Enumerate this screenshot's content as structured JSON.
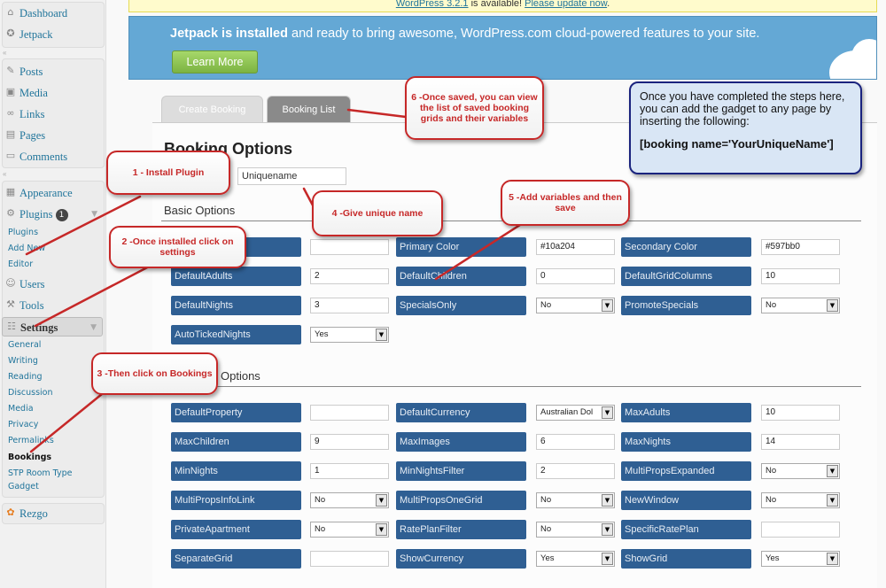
{
  "sidebar": {
    "top_items": [
      {
        "label": "Dashboard",
        "icon": "home-icon"
      },
      {
        "label": "Jetpack",
        "icon": "jetpack-icon"
      }
    ],
    "content_items": [
      {
        "label": "Posts",
        "icon": "pin-icon"
      },
      {
        "label": "Media",
        "icon": "media-icon"
      },
      {
        "label": "Links",
        "icon": "link-icon"
      },
      {
        "label": "Pages",
        "icon": "page-icon"
      },
      {
        "label": "Comments",
        "icon": "comment-icon"
      }
    ],
    "admin_items": [
      {
        "label": "Appearance",
        "icon": "appearance-icon"
      },
      {
        "label": "Plugins",
        "icon": "plugin-icon",
        "badge": "1"
      }
    ],
    "plugins_sub": [
      "Plugins",
      "Add New",
      "Editor"
    ],
    "users": {
      "label": "Users",
      "icon": "users-icon"
    },
    "tools": {
      "label": "Tools",
      "icon": "tools-icon"
    },
    "settings": {
      "label": "Settings",
      "icon": "settings-icon"
    },
    "settings_sub": [
      "General",
      "Writing",
      "Reading",
      "Discussion",
      "Media",
      "Privacy",
      "Permalinks",
      "Bookings",
      "STP Room Type",
      "Gadget"
    ],
    "rezgo": {
      "label": "Rezgo",
      "icon": "rezgo-icon"
    }
  },
  "update_notice": {
    "version": "WordPress 3.2.1",
    "text": " is available! ",
    "link": "Please update now",
    "end": "."
  },
  "jetpack_notice": {
    "bold": "Jetpack is installed",
    "text": " and ready to bring awesome, WordPress.com cloud-powered features to your site.",
    "button": "Learn More"
  },
  "tabs": {
    "create": "Create Booking",
    "list": "Booking List"
  },
  "page_title": "Booking Options",
  "unique_name_value": "Uniquename",
  "sections": {
    "basic": "Basic Options",
    "advanced": "Options"
  },
  "basic_fields": [
    {
      "label": "",
      "value": "",
      "kind": "input"
    },
    {
      "label": "Primary Color",
      "value": "#10a204",
      "kind": "input"
    },
    {
      "label": "Secondary Color",
      "value": "#597bb0",
      "kind": "input"
    },
    {
      "label": "DefaultAdults",
      "value": "2",
      "kind": "input"
    },
    {
      "label": "DefaultChildren",
      "value": "0",
      "kind": "input"
    },
    {
      "label": "DefaultGridColumns",
      "value": "10",
      "kind": "input"
    },
    {
      "label": "DefaultNights",
      "value": "3",
      "kind": "input"
    },
    {
      "label": "SpecialsOnly",
      "value": "No",
      "kind": "select"
    },
    {
      "label": "PromoteSpecials",
      "value": "No",
      "kind": "select"
    },
    {
      "label": "AutoTickedNights",
      "value": "Yes",
      "kind": "select"
    }
  ],
  "advanced_fields": [
    {
      "label": "DefaultProperty",
      "value": "",
      "kind": "input"
    },
    {
      "label": "DefaultCurrency",
      "value": "Australian Dol",
      "kind": "select"
    },
    {
      "label": "MaxAdults",
      "value": "10",
      "kind": "input"
    },
    {
      "label": "MaxChildren",
      "value": "9",
      "kind": "input"
    },
    {
      "label": "MaxImages",
      "value": "6",
      "kind": "input"
    },
    {
      "label": "MaxNights",
      "value": "14",
      "kind": "input"
    },
    {
      "label": "MinNights",
      "value": "1",
      "kind": "input"
    },
    {
      "label": "MinNightsFilter",
      "value": "2",
      "kind": "input"
    },
    {
      "label": "MultiPropsExpanded",
      "value": "No",
      "kind": "select"
    },
    {
      "label": "MultiPropsInfoLink",
      "value": "No",
      "kind": "select"
    },
    {
      "label": "MultiPropsOneGrid",
      "value": "No",
      "kind": "select"
    },
    {
      "label": "NewWindow",
      "value": "No",
      "kind": "select"
    },
    {
      "label": "PrivateApartment",
      "value": "No",
      "kind": "select"
    },
    {
      "label": "RatePlanFilter",
      "value": "No",
      "kind": "select"
    },
    {
      "label": "SpecificRatePlan",
      "value": "",
      "kind": "input"
    },
    {
      "label": "SeparateGrid",
      "value": "",
      "kind": "input"
    },
    {
      "label": "ShowCurrency",
      "value": "Yes",
      "kind": "select"
    },
    {
      "label": "ShowGrid",
      "value": "Yes",
      "kind": "select"
    }
  ],
  "annotations": {
    "step1": "1 - Install Plugin",
    "step2": "2 -Once installed click on settings",
    "step3": "3 -Then click on Bookings",
    "step4": "4 -Give unique name",
    "step5": "5 -Add variables and then save",
    "step6": "6 -Once saved, you can view the list of saved booking grids and their variables",
    "info_text": "Once you have completed the steps here, you can add the gadget to any page by inserting the following:",
    "info_code": "[booking name='YourUniqueName']"
  },
  "colors": {
    "label_bg": "#2f5f93",
    "callout": "#c62828",
    "jetpack_bg": "#64a8d5",
    "learn_more": "#8bc34a"
  }
}
